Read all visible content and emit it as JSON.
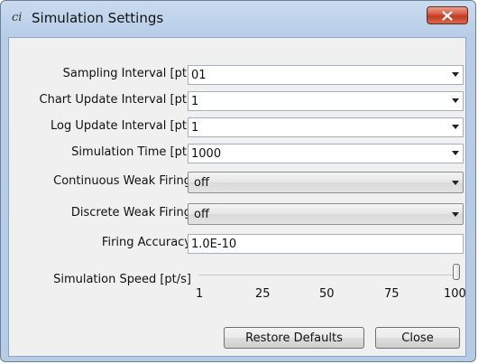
{
  "window": {
    "title": "Simulation Settings",
    "app_icon": "ci",
    "close_icon": "close-icon"
  },
  "fields": [
    {
      "label": "Sampling Interval [pt]",
      "value": "01",
      "type": "editable-combo"
    },
    {
      "label": "Chart Update Interval [pt]",
      "value": "1",
      "type": "editable-combo"
    },
    {
      "label": "Log Update Interval [pt]",
      "value": "1",
      "type": "editable-combo"
    },
    {
      "label": "Simulation Time [pt]",
      "value": "1000",
      "type": "editable-combo"
    },
    {
      "label": "Continuous Weak Firing",
      "value": "off",
      "type": "readonly-combo"
    },
    {
      "label": "Discrete Weak Firing",
      "value": "off",
      "type": "readonly-combo"
    },
    {
      "label": "Firing Accuracy",
      "value": "1.0E-10",
      "type": "text"
    }
  ],
  "slider": {
    "label": "Simulation Speed [pt/s]",
    "ticks": [
      "1",
      "25",
      "50",
      "75",
      "100"
    ],
    "value": 100,
    "min": 1,
    "max": 100
  },
  "buttons": {
    "restore": "Restore Defaults",
    "close": "Close"
  }
}
